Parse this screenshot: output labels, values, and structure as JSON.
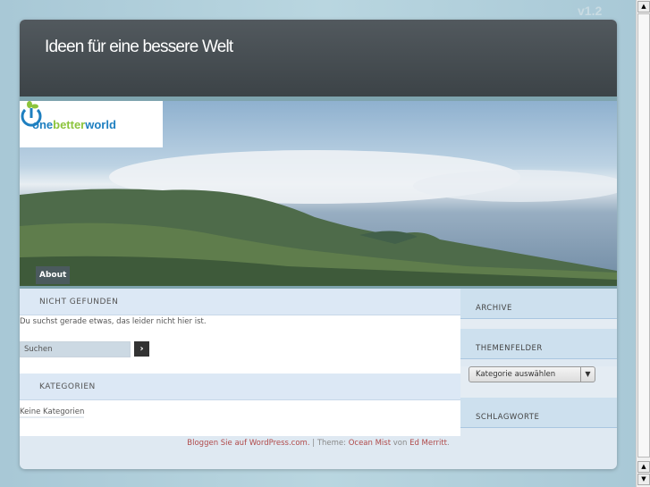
{
  "version": "v1.2",
  "site_title": "Ideen für eine bessere Welt",
  "logo": {
    "part1": "one",
    "part2": "better",
    "part3": "world"
  },
  "nav": {
    "about": "About"
  },
  "main": {
    "not_found_heading": "NICHT GEFUNDEN",
    "not_found_text": "Du suchst gerade etwas, das leider nicht hier ist.",
    "search_placeholder": "Suchen",
    "search_button": "›",
    "categories_heading": "KATEGORIEN",
    "no_categories": "Keine Kategorien"
  },
  "sidebar": {
    "archive": "ARCHIVE",
    "topics": "THEMENFELDER",
    "category_select": "Kategorie auswählen",
    "tags": "SCHLAGWORTE"
  },
  "footer": {
    "wp_link": "Bloggen Sie auf WordPress.com.",
    "sep": " | Theme: ",
    "theme_link": "Ocean Mist",
    "by": " von ",
    "author_link": "Ed Merritt",
    "end": "."
  }
}
